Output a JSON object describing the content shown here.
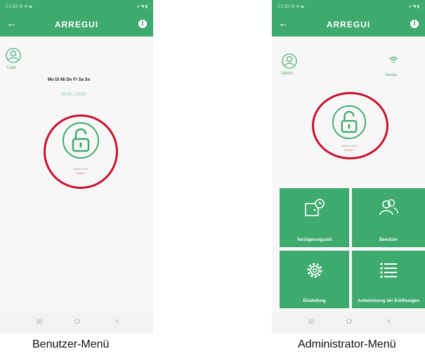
{
  "left_screen": {
    "status_time": "13:20 ⚙ ✉ ▪ ·",
    "status_icons": "▾ ◥ ▮",
    "appbar": {
      "back_icon": "←",
      "title": "ARREGUI",
      "info_icon": "i"
    },
    "avatar_label": "User",
    "days": "Mo Di Mi Do Fr Sa So",
    "hours": "00:00 | 23:59",
    "battery_label": "Battery 99%",
    "version_label": "Versión 3",
    "nav": [
      "III",
      "O",
      "<"
    ]
  },
  "right_screen": {
    "status_time": "13:20 ⚙ ✉ ▪ ·",
    "status_icons": "▾ ◥ ▮",
    "appbar": {
      "back_icon": "←",
      "title": "ARREGUI",
      "info_icon": "i"
    },
    "avatar_label": "Admin",
    "wifi_label": "Senegu",
    "battery_label": "Battery 99%",
    "version_label": "Versión 3",
    "tiles": [
      {
        "label": "Verzögerungszeit",
        "icon": "door-timer-icon"
      },
      {
        "label": "Benutzer",
        "icon": "users-icon"
      },
      {
        "label": "Einstellung",
        "icon": "gear-icon"
      },
      {
        "label": "Aufzeichnung der Eröffnungen",
        "icon": "list-icon"
      }
    ],
    "nav": [
      "III",
      "O",
      "<"
    ]
  },
  "captions": {
    "left": "Benutzer-Menü",
    "right": "Administrator-Menü"
  },
  "colors": {
    "brand": "#3faa6d",
    "highlight_circle": "#c8102e"
  }
}
